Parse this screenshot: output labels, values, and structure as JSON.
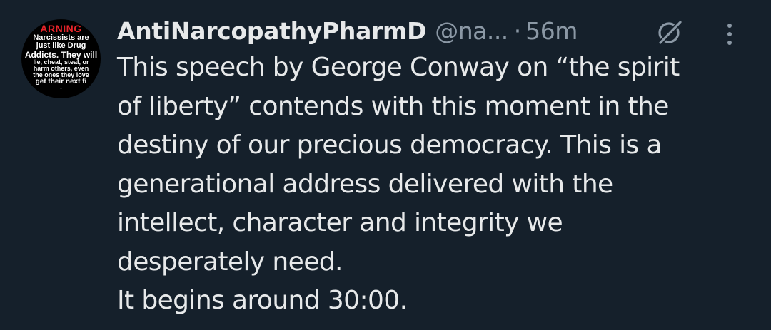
{
  "avatar": {
    "lines": [
      "ARNING",
      "Narcissists are",
      "just like Drug",
      "Addicts. They will",
      "lie, cheat, steal, or",
      "harm others, even",
      "the ones they love",
      "get their next fi",
      "...",
      "..."
    ],
    "icon": "profile-avatar"
  },
  "header": {
    "display_name": "AntiNarcopathyPharmD",
    "handle": "@na...",
    "separator": "·",
    "timestamp": "56m",
    "grok_icon": "grok-icon",
    "more_icon": "more-vertical-icon"
  },
  "tweet": {
    "lines": [
      "This speech by George Conway on “the spirit",
      "of liberty” contends with this moment in the",
      "destiny of our precious democracy. This is a",
      "generational address delivered with the",
      "intellect, character and integrity we",
      "desperately need.",
      "It begins around 30:00."
    ]
  },
  "colors": {
    "background": "#15202b",
    "primary_text": "#e7e9ea",
    "secondary_text": "#8b98a5",
    "avatar_warning": "#e8242a"
  }
}
